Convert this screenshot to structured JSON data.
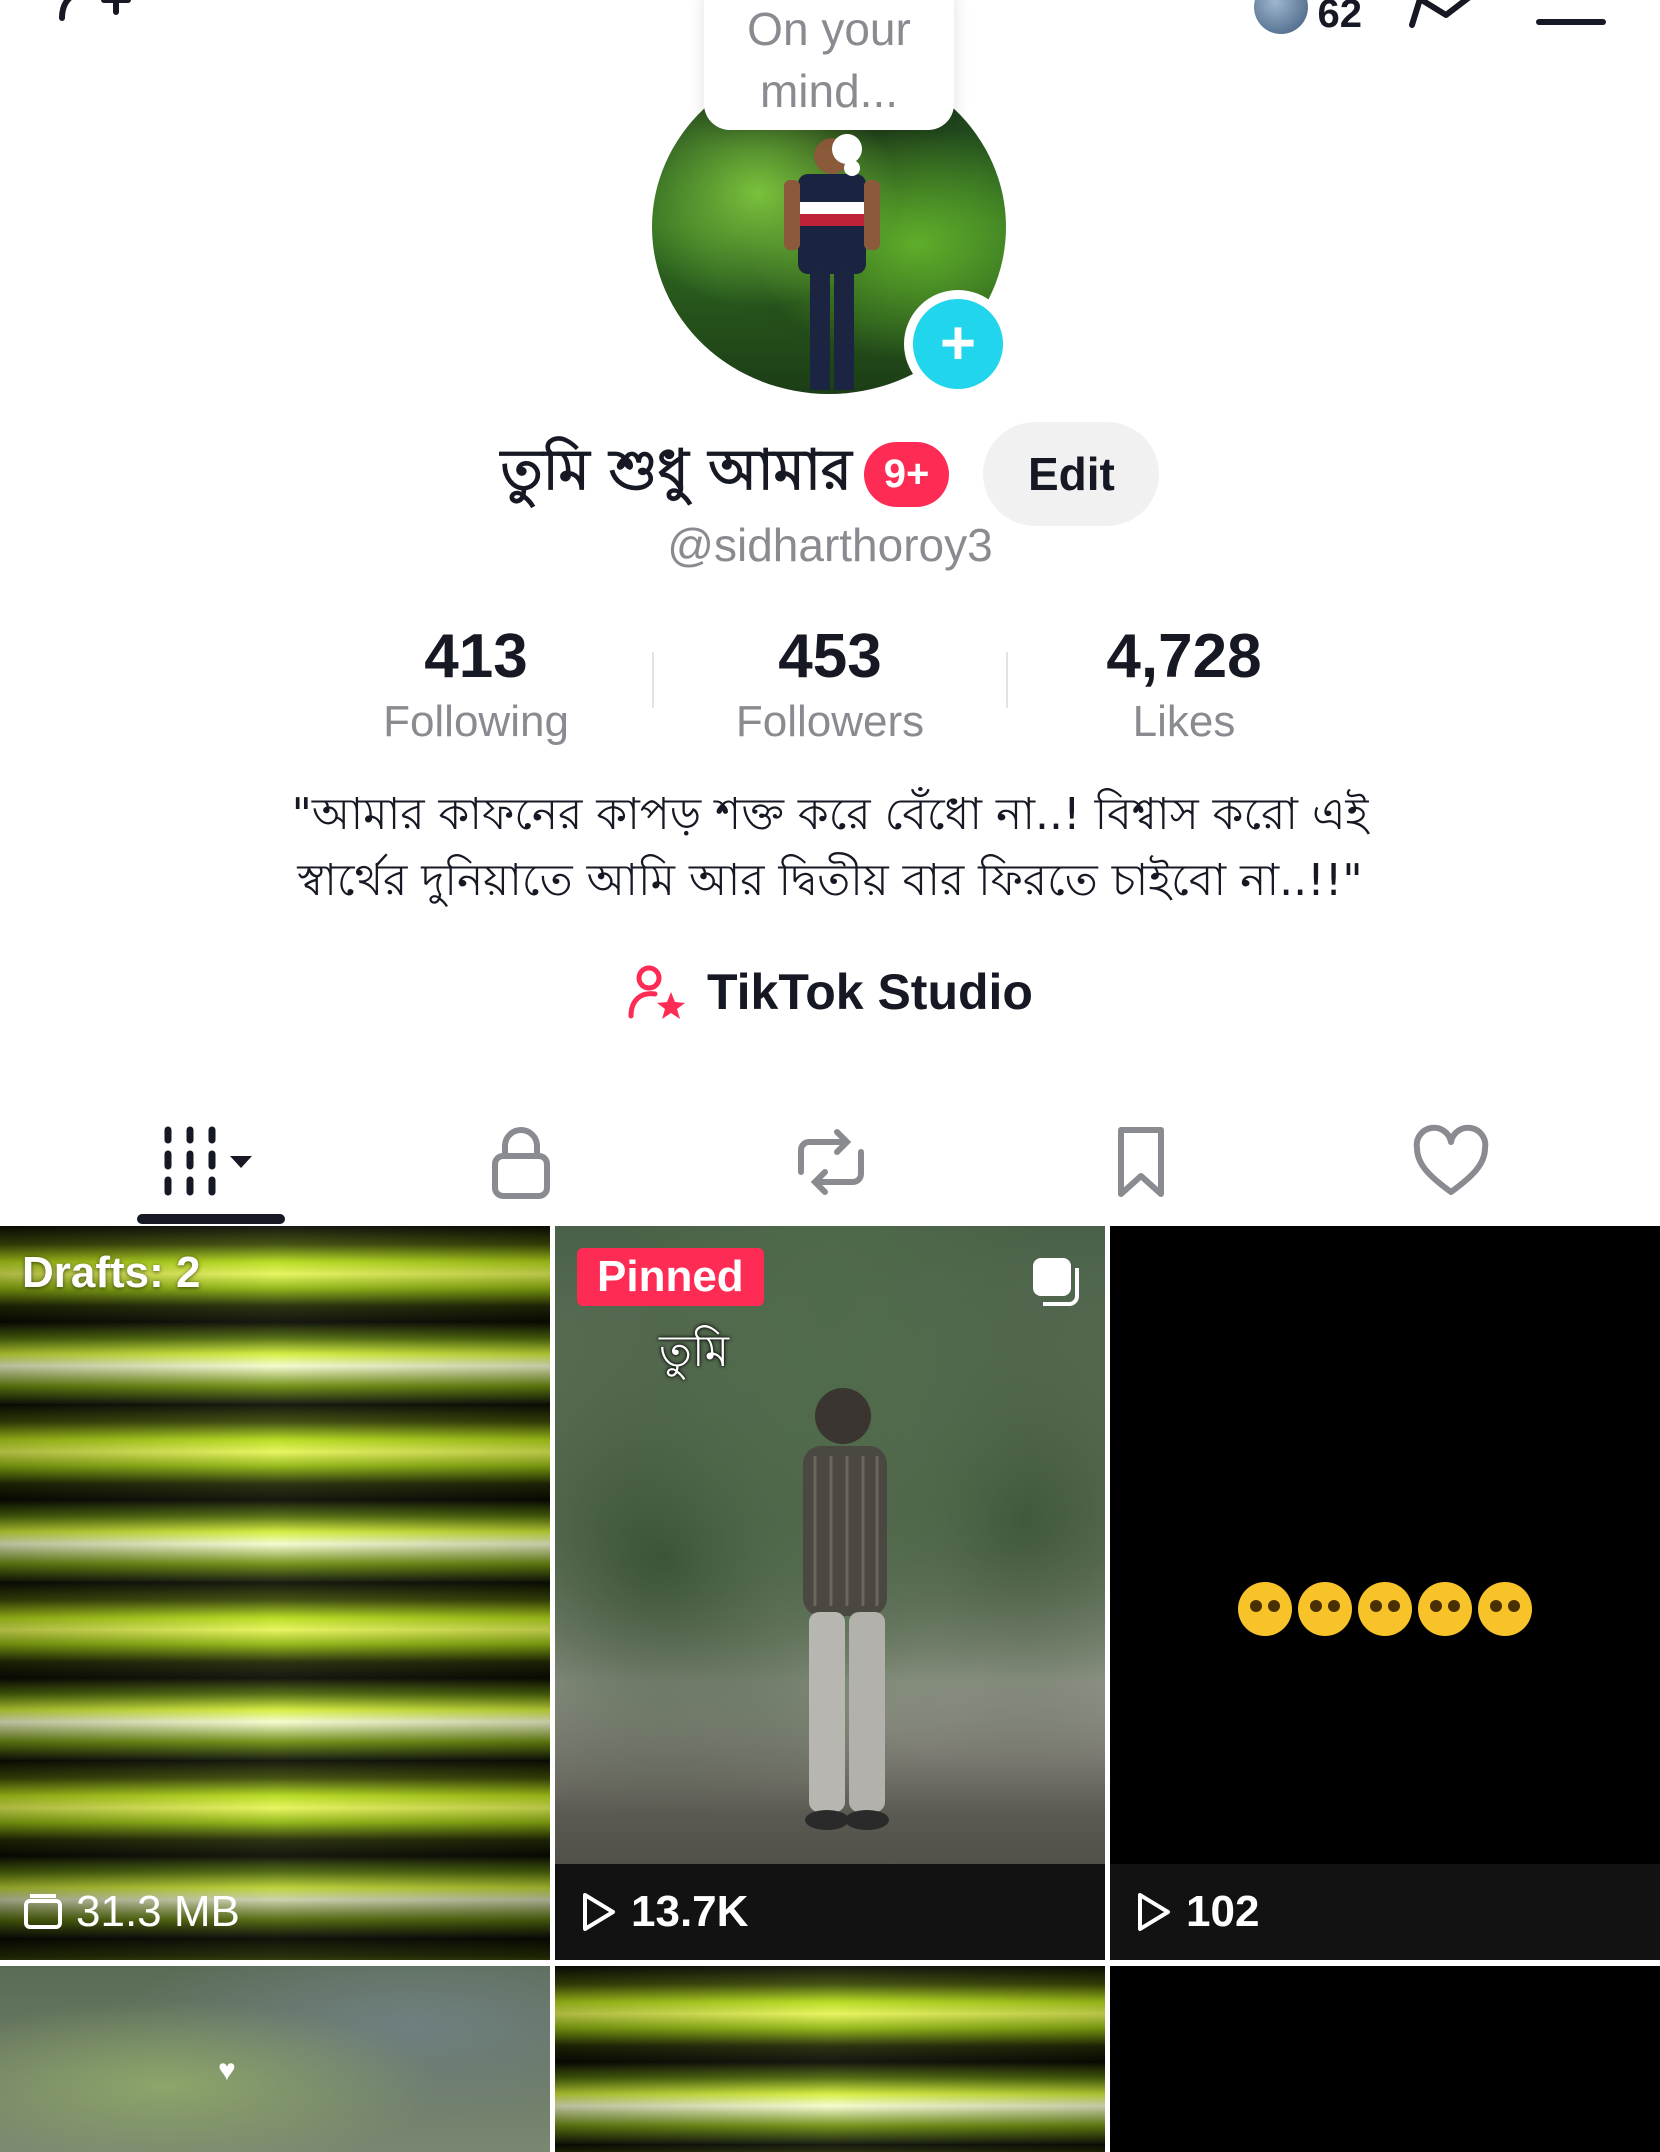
{
  "header": {
    "add_friend_icon": "person-plus-icon",
    "visitor_count": "62",
    "share_icon": "share-arrow-icon",
    "menu_icon": "hamburger-menu-icon"
  },
  "profile": {
    "thought_bubble": "On your mind...",
    "display_name": "তুমি শুধু আমার",
    "notification_badge": "9+",
    "edit_label": "Edit",
    "username": "@sidharthoroy3",
    "bio_line1": "\"আমার কাফনের কাপড় শক্ত করে বেঁধো না..! বিশ্বাস করো এই",
    "bio_line2": "স্বার্থের দুনিয়াতে আমি আর দ্বিতীয় বার ফিরতে চাইবো না..!!\""
  },
  "stats": [
    {
      "value": "413",
      "label": "Following"
    },
    {
      "value": "453",
      "label": "Followers"
    },
    {
      "value": "4,728",
      "label": "Likes"
    }
  ],
  "studio": {
    "label": "TikTok Studio",
    "icon": "creator-star-icon"
  },
  "tabs": [
    {
      "name": "videos",
      "icon": "grid-icon",
      "active": true
    },
    {
      "name": "private",
      "icon": "lock-icon"
    },
    {
      "name": "reposts",
      "icon": "repost-icon"
    },
    {
      "name": "favorites",
      "icon": "bookmark-icon"
    },
    {
      "name": "liked",
      "icon": "heart-icon"
    }
  ],
  "videos": [
    {
      "label": "Drafts: 2",
      "footer": "31.3 MB"
    },
    {
      "label": "Pinned",
      "caption": "তুমি",
      "footer": "13.7K"
    },
    {
      "footer": "102"
    }
  ],
  "colors": {
    "accent_red": "#fe2c55",
    "accent_cyan": "#20d5ec",
    "text_primary": "#161823",
    "text_secondary": "#8a8b91"
  }
}
